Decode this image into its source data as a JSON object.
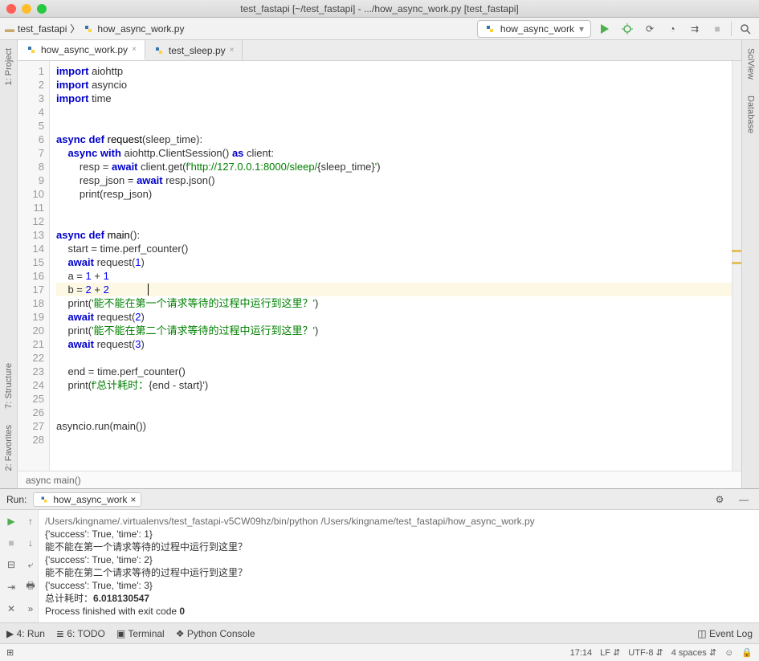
{
  "title": "test_fastapi [~/test_fastapi] - .../how_async_work.py [test_fastapi]",
  "crumbs": {
    "root": "test_fastapi",
    "file": "how_async_work.py"
  },
  "run_config": "how_async_work",
  "tabs": [
    {
      "label": "how_async_work.py",
      "active": true
    },
    {
      "label": "test_sleep.py",
      "active": false
    }
  ],
  "left_tools": {
    "project": "1: Project",
    "structure": "7: Structure",
    "favorites": "2: Favorites"
  },
  "right_tools": {
    "sciview": "SciView",
    "database": "Database"
  },
  "code": {
    "lines": [
      {
        "n": 1,
        "html": "<span class='kw'>import</span> aiohttp"
      },
      {
        "n": 2,
        "html": "<span class='kw'>import</span> asyncio"
      },
      {
        "n": 3,
        "html": "<span class='kw'>import</span> time"
      },
      {
        "n": 4,
        "html": ""
      },
      {
        "n": 5,
        "html": ""
      },
      {
        "n": 6,
        "html": "<span class='kw'>async def</span> <span class='fn'>request</span>(sleep_time):"
      },
      {
        "n": 7,
        "html": "    <span class='kw'>async with</span> aiohttp.ClientSession() <span class='kw'>as</span> client:"
      },
      {
        "n": 8,
        "html": "        resp = <span class='kw'>await</span> client.get(<span class='str'>f'http://127.0.0.1:8000/sleep/</span>{sleep_time}<span class='str'>'</span>)"
      },
      {
        "n": 9,
        "html": "        resp_json = <span class='kw'>await</span> resp.json()"
      },
      {
        "n": 10,
        "html": "        print(resp_json)"
      },
      {
        "n": 11,
        "html": ""
      },
      {
        "n": 12,
        "html": ""
      },
      {
        "n": 13,
        "html": "<span class='kw'>async def</span> <span class='fn'>main</span>():"
      },
      {
        "n": 14,
        "html": "    start = time.perf_counter()"
      },
      {
        "n": 15,
        "html": "    <span class='kw'>await</span> request(<span class='num'>1</span>)"
      },
      {
        "n": 16,
        "html": "    a = <span class='num'>1</span> + <span class='num'>1</span>"
      },
      {
        "n": 17,
        "hl": true,
        "html": "    b = <span class='num'>2</span> + <span class='num'>2</span>"
      },
      {
        "n": 18,
        "html": "    print(<span class='str'>'能不能在第一个请求等待的过程中运行到这里？'</span>)"
      },
      {
        "n": 19,
        "html": "    <span class='kw'>await</span> request(<span class='num'>2</span>)"
      },
      {
        "n": 20,
        "html": "    print(<span class='str'>'能不能在第二个请求等待的过程中运行到这里？'</span>)"
      },
      {
        "n": 21,
        "html": "    <span class='kw'>await</span> request(<span class='num'>3</span>)"
      },
      {
        "n": 22,
        "html": ""
      },
      {
        "n": 23,
        "html": "    end = time.perf_counter()"
      },
      {
        "n": 24,
        "html": "    print(<span class='str'>f'总计耗时：</span>{end - start}<span class='str'>'</span>)"
      },
      {
        "n": 25,
        "html": ""
      },
      {
        "n": 26,
        "html": ""
      },
      {
        "n": 27,
        "html": "asyncio.run(main())"
      },
      {
        "n": 28,
        "html": ""
      }
    ],
    "breadcrumb": "async main()"
  },
  "run": {
    "title": "Run:",
    "tab": "how_async_work",
    "output": [
      {
        "cls": "path",
        "t": "/Users/kingname/.virtualenvs/test_fastapi-v5CW09hz/bin/python /Users/kingname/test_fastapi/how_async_work.py"
      },
      {
        "t": "{'success': True, 'time': 1}"
      },
      {
        "t": "能不能在第一个请求等待的过程中运行到这里？"
      },
      {
        "t": "{'success': True, 'time': 2}"
      },
      {
        "t": "能不能在第二个请求等待的过程中运行到这里？"
      },
      {
        "t": "{'success': True, 'time': 3}"
      },
      {
        "html": "总计耗时：<span class='bold'>6.018130547</span>"
      },
      {
        "t": ""
      },
      {
        "html": "Process finished with exit code <span class='bold'>0</span>"
      }
    ]
  },
  "bottom": {
    "run": "4: Run",
    "todo": "6: TODO",
    "terminal": "Terminal",
    "pyconsole": "Python Console",
    "eventlog": "Event Log"
  },
  "status": {
    "pos": "17:14",
    "le": "LF",
    "enc": "UTF-8",
    "indent": "4 spaces"
  }
}
